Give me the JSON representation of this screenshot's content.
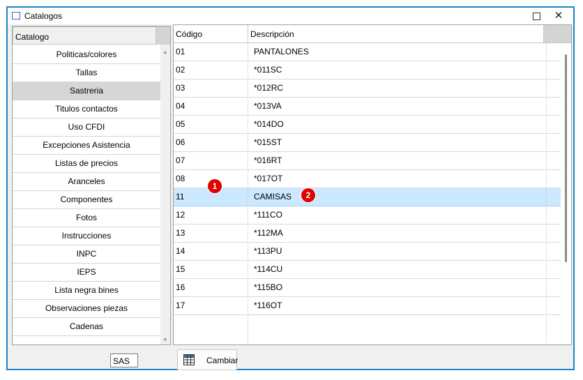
{
  "window": {
    "title": "Catalogos",
    "maximize_icon": "maximize-icon",
    "close_symbol": "✕"
  },
  "left_panel": {
    "header": "Catalogo",
    "items": [
      {
        "label": "Politicas/colores"
      },
      {
        "label": "Tallas"
      },
      {
        "label": "Sastreria",
        "selected": true
      },
      {
        "label": "Titulos contactos"
      },
      {
        "label": "Uso CFDI"
      },
      {
        "label": "Excepciones Asistencia"
      },
      {
        "label": "Listas de precios"
      },
      {
        "label": "Aranceles"
      },
      {
        "label": "Componentes"
      },
      {
        "label": "Fotos"
      },
      {
        "label": "Instrucciones"
      },
      {
        "label": "INPC"
      },
      {
        "label": "IEPS"
      },
      {
        "label": "Lista negra bines"
      },
      {
        "label": "Observaciones piezas"
      },
      {
        "label": "Cadenas"
      },
      {
        "label": ""
      }
    ]
  },
  "grid": {
    "columns": [
      "Código",
      "Descripción"
    ],
    "rows": [
      {
        "codigo": "01",
        "descripcion": "PANTALONES"
      },
      {
        "codigo": "02",
        "descripcion": "*011SC"
      },
      {
        "codigo": "03",
        "descripcion": "*012RC"
      },
      {
        "codigo": "04",
        "descripcion": "*013VA"
      },
      {
        "codigo": "05",
        "descripcion": "*014DO"
      },
      {
        "codigo": "06",
        "descripcion": "*015ST"
      },
      {
        "codigo": "07",
        "descripcion": "*016RT"
      },
      {
        "codigo": "08",
        "descripcion": "*017OT"
      },
      {
        "codigo": "11",
        "descripcion": "CAMISAS",
        "selected": true
      },
      {
        "codigo": "12",
        "descripcion": "*111CO"
      },
      {
        "codigo": "13",
        "descripcion": "*112MA"
      },
      {
        "codigo": "14",
        "descripcion": "*113PU"
      },
      {
        "codigo": "15",
        "descripcion": "*114CU"
      },
      {
        "codigo": "16",
        "descripcion": "*115BO"
      },
      {
        "codigo": "17",
        "descripcion": "*116OT"
      }
    ]
  },
  "annotations": {
    "badge_1": "1",
    "badge_2": "2",
    "badge_color": "#e00000"
  },
  "bottom": {
    "code_value": "SAS",
    "cambiar_label": "Cambiar",
    "cambiar_icon": "grid-table-icon"
  },
  "colors": {
    "window_border": "#1c86c8",
    "selected_row": "#cce8ff",
    "selected_left_item": "#d6d6d6"
  }
}
